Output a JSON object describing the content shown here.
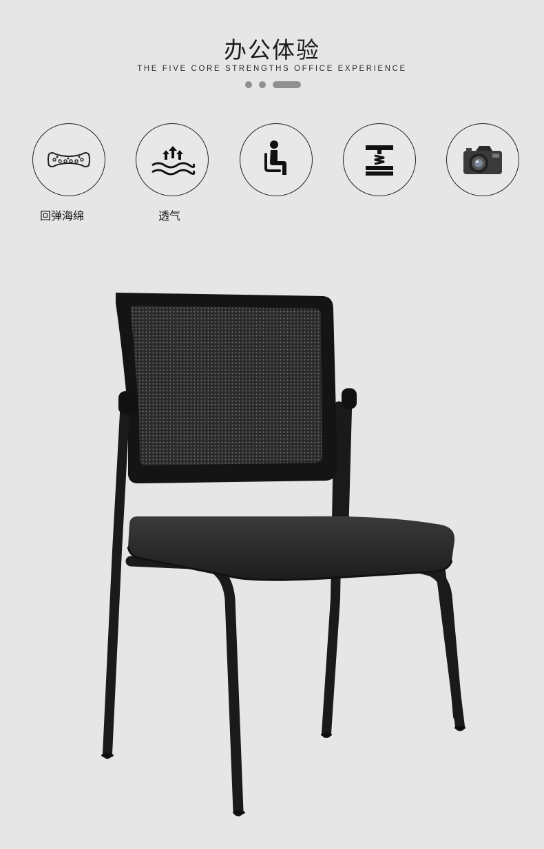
{
  "header": {
    "title": "办公体验",
    "subtitle": "THE FIVE CORE STRENGTHS  OFFICE EXPERIENCE"
  },
  "pager": {
    "count": 3,
    "active_index": 2
  },
  "features": [
    {
      "icon": "sponge-icon",
      "label": "回弹海绵"
    },
    {
      "icon": "breathable-icon",
      "label": "透气"
    },
    {
      "icon": "seated-person-icon",
      "label": ""
    },
    {
      "icon": "spring-support-icon",
      "label": ""
    },
    {
      "icon": "camera-icon",
      "label": ""
    }
  ],
  "product": {
    "image": "office-chair-image"
  }
}
